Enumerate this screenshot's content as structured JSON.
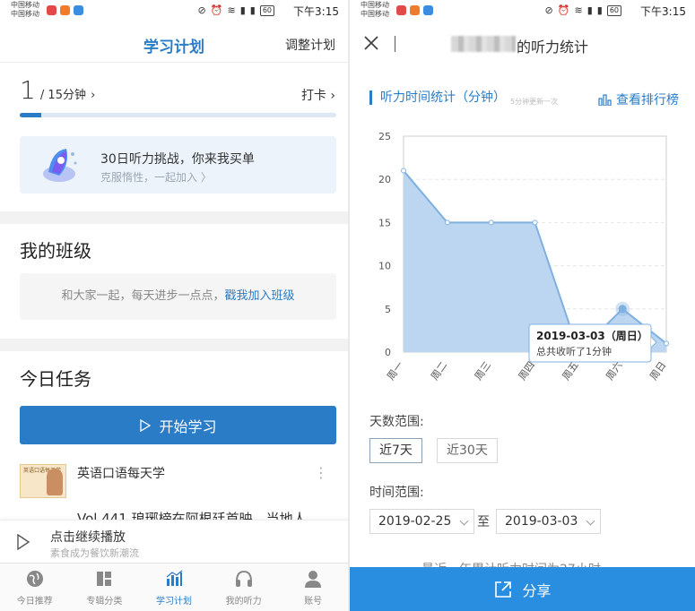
{
  "status_bar": {
    "carrier1": "中国移动",
    "carrier2": "中国移动",
    "network": "26",
    "network2": "46",
    "battery": "60",
    "time": "下午3:15"
  },
  "plan": {
    "title": "学习计划",
    "adjust_label": "调整计划",
    "progress_current": "1",
    "progress_goal": "/ 15分钟",
    "checkin_label": "打卡",
    "progress_fraction": 0.067,
    "challenge_title": "30日听力挑战，你来我买单",
    "challenge_sub": "克服惰性，一起加入 〉",
    "class_title": "我的班级",
    "class_prompt": "和大家一起，每天进步一点点，",
    "class_link": "戳我加入班级",
    "task_title": "今日任务",
    "start_label": "开始学习",
    "course_thumb_text": "英语口语每天学",
    "course_name": "英语口语每天学",
    "course_title": "Vol.441 琅琊榜在阿根廷首映，当地人",
    "player_title": "点击继续播放",
    "player_sub": "素食成为餐饮新潮流"
  },
  "tabs": [
    {
      "label": "今日推荐",
      "icon": "globe-icon"
    },
    {
      "label": "专辑分类",
      "icon": "grid-icon"
    },
    {
      "label": "学习计划",
      "icon": "bar-chart-icon",
      "active": true
    },
    {
      "label": "我的听力",
      "icon": "headphones-icon"
    },
    {
      "label": "账号",
      "icon": "user-icon"
    }
  ],
  "stats": {
    "page_title": "的听力统计",
    "section_label": "听力时间统计（分钟）",
    "section_note": "5分钟更新一次",
    "ranking_label": "查看排行榜",
    "days_label": "天数范围:",
    "range_7": "近7天",
    "range_30": "近30天",
    "time_label": "时间范围:",
    "date_from": "2019-02-25",
    "to_label": "至",
    "date_to": "2019-03-03",
    "hidden_line": "最近一年累计听力时间为27小时",
    "share_label": "分享",
    "tooltip_title": "2019-03-03（周日）",
    "tooltip_body": "总共收听了1分钟"
  },
  "chart_data": {
    "type": "area",
    "categories": [
      "周一",
      "周二",
      "周三",
      "周四",
      "周五",
      "周六",
      "周日"
    ],
    "values": [
      21,
      15,
      15,
      15,
      0,
      5,
      1
    ],
    "ylim": [
      0,
      25
    ],
    "yticks": [
      0,
      5,
      10,
      15,
      20,
      25
    ],
    "grid": true,
    "legend": "none",
    "line_color": "#7fb0e0",
    "fill_color": "#bcd6f1",
    "highlight_index": 6
  },
  "colors": {
    "accent": "#2a7cc7",
    "share": "#2a8ee0"
  }
}
